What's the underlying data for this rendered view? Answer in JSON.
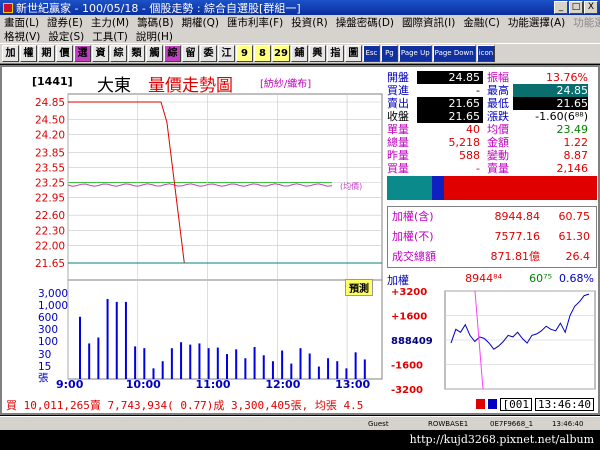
{
  "window": {
    "title": "新世紀贏家 - 100/05/18 - 個股走勢 : 綜合自選股[群組一]",
    "min_label": "_",
    "max_label": "□",
    "close_label": "X"
  },
  "menu1": [
    "畫面(L)",
    "證券(E)",
    "主力(M)",
    "籌碼(B)",
    "期權(Q)",
    "匯市利率(F)",
    "投資(R)",
    "操盤密碼(D)",
    "國際資訊(I)",
    "金融(C)",
    "功能選擇(A)",
    "功能選擇(O)"
  ],
  "menu2": [
    "格視(V)",
    "設定(S)",
    "工具(T)",
    "說明(H)"
  ],
  "toolbar": [
    "加",
    "權",
    "期",
    "價",
    "選",
    "資",
    "綜",
    "類",
    "觸",
    "綜",
    "留",
    "委",
    "江",
    "9",
    "8",
    "29",
    "鋪",
    "興",
    "指",
    "圖"
  ],
  "toolbar_icons": [
    "Esc",
    "Pg",
    "Page Up",
    "Page Down",
    "icon"
  ],
  "stock": {
    "code": "[1441]",
    "name": "大東",
    "chart_title": "量價走勢圖",
    "industry": "[紡紗/織布]",
    "vol_badge": "預測",
    "avg_label": "(均價)"
  },
  "quote": {
    "rows": [
      {
        "l1": "開盤",
        "v1": "24.85",
        "s1": "blk",
        "l2": "振幅",
        "v2": "13.76%",
        "s2": "red"
      },
      {
        "l1": "買進",
        "v1": "-",
        "s1": "plain",
        "l2": "最高",
        "v2": "24.85",
        "s2": "teal"
      },
      {
        "l1": "賣出",
        "v1": "21.65",
        "s1": "blk",
        "l2": "最低",
        "v2": "21.65",
        "s2": "blk"
      },
      {
        "l1": "收盤",
        "v1": "21.65",
        "s1": "blk",
        "l2": "漲跌",
        "v2": "-1.60(6⁸⁸)",
        "s2": "plain"
      },
      {
        "l1": "單量",
        "v1": "40",
        "s1": "red",
        "l2": "均價",
        "v2": "23.49",
        "s2": "green"
      },
      {
        "l1": "總量",
        "v1": "5,218",
        "s1": "red",
        "l2": "金額",
        "v2": "1.22",
        "s2": "red"
      },
      {
        "l1": "昨量",
        "v1": "588",
        "s1": "red",
        "l2": "變動",
        "v2": "8.87",
        "s2": "red"
      },
      {
        "l1": "買量",
        "v1": "-",
        "s1": "red",
        "l2": "賣量",
        "v2": "2,146",
        "s2": "red"
      }
    ]
  },
  "index_panel": [
    {
      "label": "加權(含)",
      "value": "8944.84",
      "change": "60.75"
    },
    {
      "label": "加權(不)",
      "value": "7577.16",
      "change": "61.30"
    },
    {
      "label": "成交總額",
      "value": "871.81億",
      "change": "26.4"
    }
  ],
  "mini": {
    "label": "加權",
    "value": "8944⁸⁴",
    "change": "60⁷⁵",
    "pct": "0.68%",
    "y_ticks": [
      "+3200",
      "+1600",
      "888409",
      "-1600",
      "-3200"
    ]
  },
  "status": {
    "text": "買 10,011,265賣 7,743,934( 0.77)成 3,300,405張, 均張 4.5",
    "input": "[001",
    "time": "13:46:40",
    "colors": [
      "#e00000",
      "#0000c0"
    ]
  },
  "taskbar": [
    "Guest",
    "ROWBASE1",
    "0E7F9668_1",
    "13:46:40"
  ],
  "watermark": "http://kujd3268.pixnet.net/album",
  "chart_data": {
    "type": "line",
    "price": {
      "x": [
        "9:00",
        "10:20",
        "10:25",
        "10:40",
        "13:30"
      ],
      "y": [
        24.85,
        24.85,
        24.45,
        21.65,
        21.65
      ],
      "avg_y": 23.2
    },
    "y_ticks": [
      "24.85",
      "24.50",
      "24.20",
      "23.85",
      "23.55",
      "23.25",
      "22.95",
      "22.60",
      "22.30",
      "22.00",
      "21.65"
    ],
    "ylim": [
      21.65,
      24.85
    ],
    "reference": 23.25,
    "x_ticks": [
      "9:00",
      "10:00",
      "11:00",
      "12:00",
      "13:00"
    ],
    "volume": {
      "y_ticks": [
        "3,000",
        "1,000",
        "600",
        "300",
        "100",
        "30",
        "15",
        "張"
      ],
      "bars": [
        1050,
        600,
        700,
        1350,
        1300,
        1300,
        550,
        520,
        180,
        300,
        520,
        620,
        580,
        600,
        520,
        530,
        420,
        500,
        350,
        540,
        400,
        300,
        480,
        260,
        520,
        430,
        210,
        350,
        300,
        180,
        450,
        330
      ]
    },
    "mini_index": {
      "ylim": [
        -3200,
        3200
      ],
      "values": [
        -200,
        700,
        500,
        1000,
        300,
        -100,
        200,
        100,
        -200,
        -600,
        -400,
        -100,
        300,
        200,
        500,
        100,
        -200,
        300,
        400,
        600,
        900,
        700,
        600,
        1100,
        500,
        1600,
        2200,
        2500,
        2900,
        3000
      ]
    }
  }
}
